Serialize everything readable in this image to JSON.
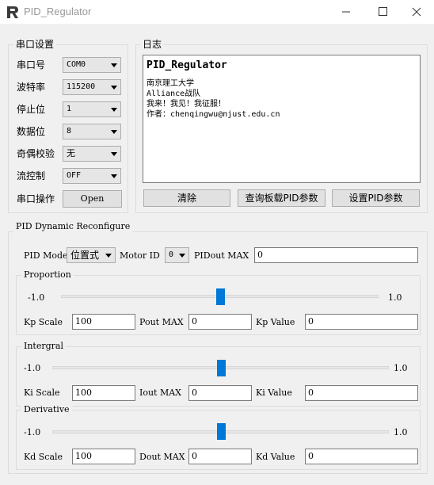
{
  "window": {
    "title": "PID_Regulator"
  },
  "serial": {
    "group_title": "串口设置",
    "rows": [
      {
        "label": "串口号",
        "value": "COM0"
      },
      {
        "label": "波特率",
        "value": "115200"
      },
      {
        "label": "停止位",
        "value": "1"
      },
      {
        "label": "数据位",
        "value": "8"
      },
      {
        "label": "奇偶校验",
        "value": "无"
      },
      {
        "label": "流控制",
        "value": "OFF"
      }
    ],
    "op_label": "串口操作",
    "open_button": "Open"
  },
  "log": {
    "group_title": "日志",
    "title": "PID_Regulator",
    "lines": [
      "南京理工大学",
      "Alliance战队",
      "我来！我见！我征服！",
      "作者：chenqingwu@njust.edu.cn"
    ],
    "buttons": {
      "clear": "清除",
      "query": "查询板载PID参数",
      "set": "设置PID参数"
    }
  },
  "pid": {
    "group_title": "PID Dynamic Reconfigure",
    "mode_label": "PID Mode",
    "mode_value": "位置式",
    "motor_label": "Motor ID",
    "motor_value": "0",
    "out_max_label": "PIDout MAX",
    "out_max_value": "0",
    "proportion": {
      "title": "Proportion",
      "min": "-1.0",
      "max": "1.0",
      "slider_value": 0.0,
      "scale_label": "Kp Scale",
      "scale_value": "100",
      "max_label": "Pout MAX",
      "max_value": "0",
      "value_label": "Kp Value",
      "value": "0"
    },
    "integral": {
      "title": "Intergral",
      "min": "-1.0",
      "max": "1.0",
      "slider_value": 0.0,
      "scale_label": "Ki Scale",
      "scale_value": "100",
      "max_label": "Iout MAX",
      "max_value": "0",
      "value_label": "Ki Value",
      "value": "0"
    },
    "derivative": {
      "title": "Derivative",
      "min": "-1.0",
      "max": "1.0",
      "slider_value": 0.0,
      "scale_label": "Kd Scale",
      "scale_value": "100",
      "max_label": "Dout MAX",
      "max_value": "0",
      "value_label": "Kd Value",
      "value": "0"
    }
  },
  "colors": {
    "accent": "#0078d7",
    "window_bg": "#f0f0f0"
  }
}
